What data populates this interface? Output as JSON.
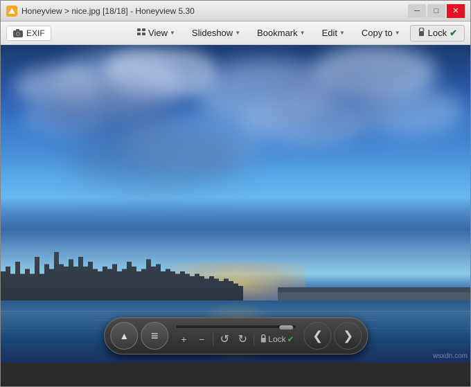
{
  "window": {
    "title": "Honeyview > nice.jpg [18/18] - Honeyview 5.30",
    "icon_label": "H",
    "controls": {
      "minimize": "─",
      "maximize": "□",
      "close": "✕"
    }
  },
  "menubar": {
    "exif_label": "EXIF",
    "view_label": "View",
    "slideshow_label": "Slideshow",
    "bookmark_label": "Bookmark",
    "edit_label": "Edit",
    "copy_to_label": "Copy to",
    "lock_label": "Lock"
  },
  "toolbar": {
    "eject_symbol": "▲",
    "menu_symbol": "≡",
    "zoom_in": "+",
    "zoom_out": "−",
    "rotate_ccw": "↺",
    "rotate_cw": "↻",
    "lock_label": "Lock",
    "lock_check": "✔",
    "prev_symbol": "❮",
    "next_symbol": "❯"
  },
  "watermark": {
    "text": "wsxdn.com"
  },
  "image": {
    "filename": "nice.jpg",
    "description": "City skyline at dusk with river reflection"
  }
}
